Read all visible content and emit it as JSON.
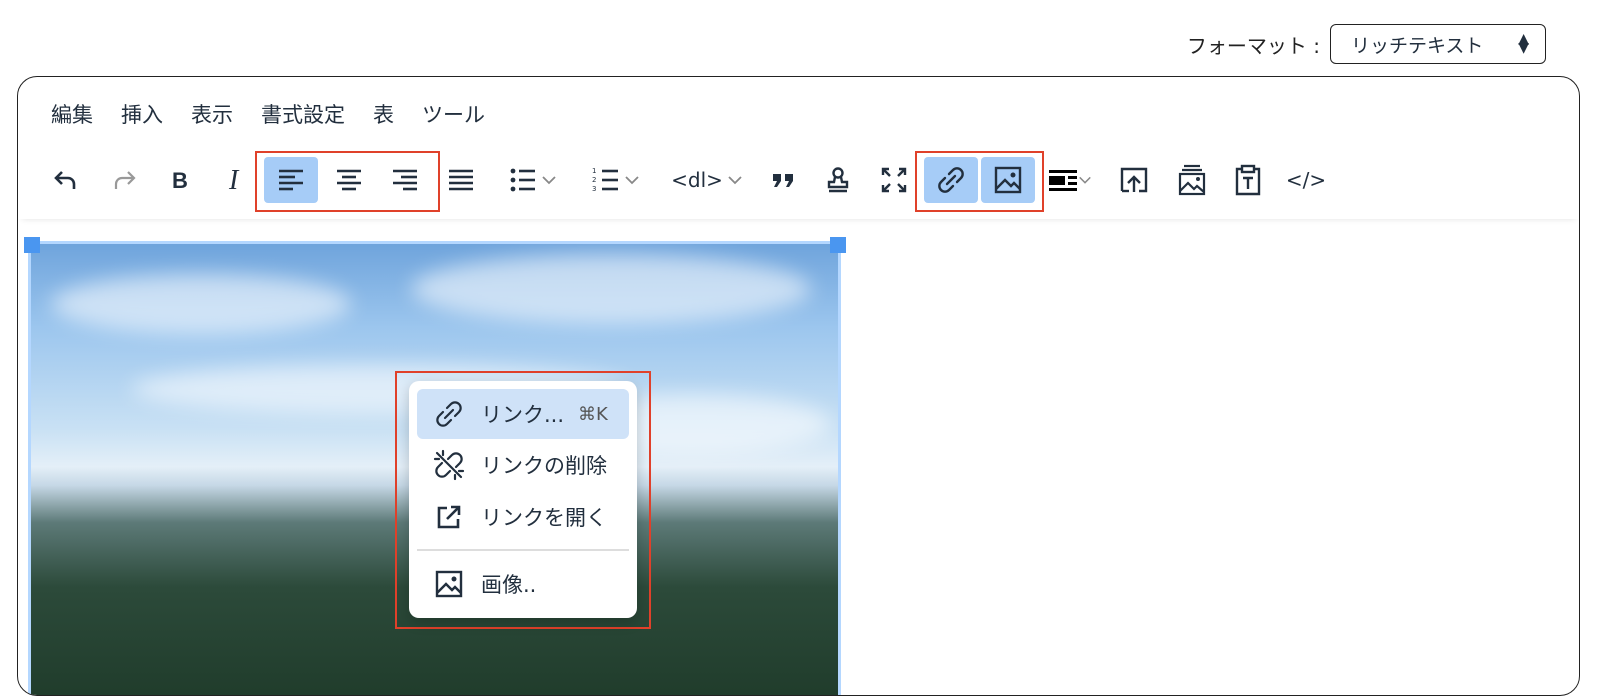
{
  "format": {
    "label": "フォーマット :",
    "value": "リッチテキスト"
  },
  "menubar": [
    "編集",
    "挿入",
    "表示",
    "書式設定",
    "表",
    "ツール"
  ],
  "toolbar": {
    "dl_label": "<dl>",
    "code_label": "</>"
  },
  "context_menu": {
    "items": [
      {
        "label": "リンク...",
        "shortcut": "⌘K",
        "icon": "link-icon"
      },
      {
        "label": "リンクの削除",
        "icon": "unlink-icon"
      },
      {
        "label": "リンクを開く",
        "icon": "open-link-icon"
      },
      {
        "label": "画像..",
        "icon": "image-icon"
      }
    ]
  },
  "colors": {
    "accent": "#a6ccf7",
    "highlight_border": "#e0412a",
    "selection": "#4a96f0"
  }
}
